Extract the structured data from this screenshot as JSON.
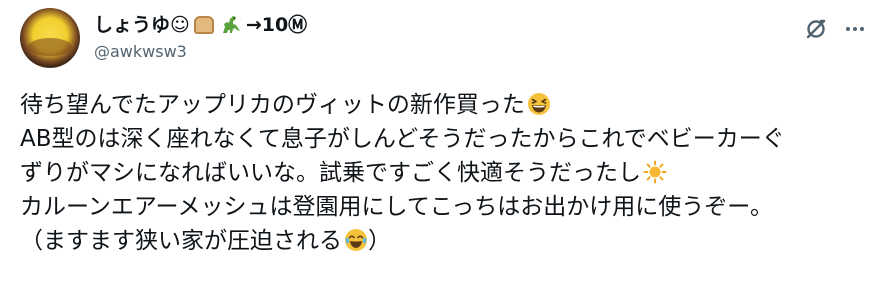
{
  "post": {
    "author": {
      "display_name_prefix": "しょうゆ☺",
      "display_name_suffix": "→10Ⓜ",
      "handle": "@awkwsw3",
      "avatar_icon": "omelet-rice-avatar",
      "name_icons": [
        "bread-icon",
        "dinosaur-icon"
      ]
    },
    "actions": {
      "grok_icon": "grok-icon",
      "more_icon": "more-icon"
    },
    "text_lines": [
      "待ち望んでたアップリカのヴィットの新作買った",
      "AB型のは深く座れなくて息子がしんどそうだったからこれでベビーカーぐ",
      "ずりがマシになればいいな。試乗ですごく快適そうだったし",
      "カルーンエアーメッシュは登園用にしてこっちはお出かけ用に使うぞー。",
      "（ますます狭い家が圧迫される",
      "）"
    ],
    "inline_emoji": [
      "grinning-squinting-face-icon",
      "sun-icon",
      "crying-laughing-face-icon"
    ],
    "colors": {
      "text": "#0f1419",
      "secondary": "#536471",
      "emoji_yellow": "#f6c13b"
    }
  }
}
